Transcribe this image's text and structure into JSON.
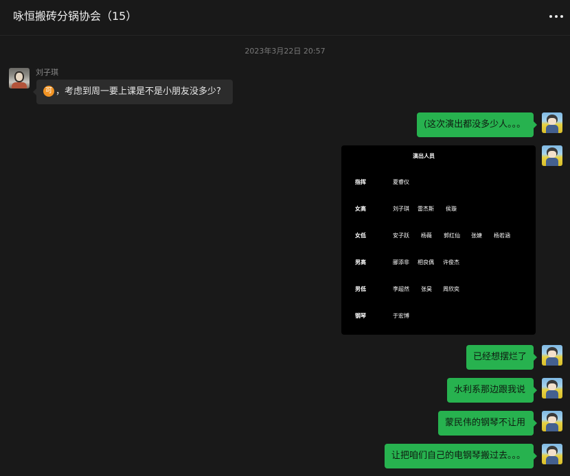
{
  "chat": {
    "title": "咏恒搬砖分锅协会（15）",
    "more_icon": "more-horizontal-icon"
  },
  "timestamp": "2023年3月22日 20:57",
  "messages": [
    {
      "sender": "刘子琪",
      "side": "left",
      "emoji": "可",
      "text": "，考虑到周一要上课是不是小朋友没多少?"
    },
    {
      "side": "right",
      "text": "(这次演出都没多少人。。。"
    },
    {
      "side": "right",
      "type": "image",
      "image": {
        "title": "演出人员",
        "rows": [
          {
            "role": "指挥",
            "names": [
              "夏睿仪"
            ]
          },
          {
            "role": "女高",
            "names": [
              "刘子琪",
              "雷杰斯",
              "侯璇"
            ]
          },
          {
            "role": "女低",
            "names": [
              "安子跃",
              "杨薇",
              "郭红仙",
              "张婕",
              "杨若涵"
            ]
          },
          {
            "role": "男高",
            "names": [
              "郦添非",
              "相良偶",
              "许俊杰"
            ]
          },
          {
            "role": "男低",
            "names": [
              "李超然",
              "张昊",
              "周欣奕"
            ]
          },
          {
            "role": "钢琴",
            "names": [
              "于宏博"
            ]
          }
        ]
      }
    },
    {
      "side": "right",
      "text": "已经想摆烂了"
    },
    {
      "side": "right",
      "text": "水利系那边跟我说"
    },
    {
      "side": "right",
      "text": "蒙民伟的钢琴不让用"
    },
    {
      "side": "right",
      "text": "让把咱们自己的电钢琴搬过去。。。"
    }
  ],
  "colors": {
    "background": "#191919",
    "self_bubble": "#27b24f",
    "other_bubble": "#2c2c2c",
    "emoji_badge": "#f29424"
  }
}
